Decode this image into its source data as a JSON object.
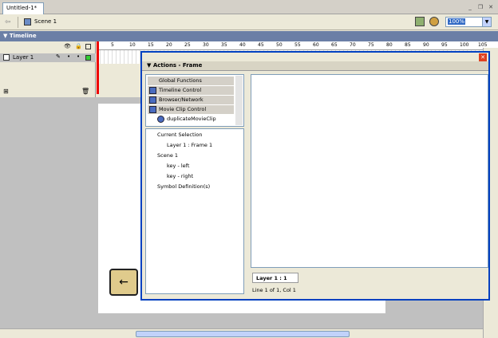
{
  "document": {
    "tab_label": "Untitled-1*"
  },
  "edit_bar": {
    "scene_label": "Scene 1",
    "zoom_value": "100%"
  },
  "timeline": {
    "header": "Timeline",
    "layer_name": "Layer 1",
    "ruler_ticks": [
      "5",
      "10",
      "15",
      "20",
      "25",
      "30",
      "35",
      "40",
      "45",
      "50",
      "55",
      "60",
      "65",
      "70",
      "75",
      "80",
      "85",
      "90",
      "95",
      "100",
      "105"
    ]
  },
  "actions_panel": {
    "title": "Actions - Frame",
    "toolbox_items": [
      "Global Functions",
      "Timeline Control",
      "Browser/Network",
      "Movie Clip Control",
      "duplicateMovieClip"
    ],
    "tree": {
      "current_selection": "Current Selection",
      "current_frame": "Layer 1 : Frame 1",
      "scene": "Scene 1",
      "items": [
        "key - left",
        "key - right"
      ],
      "symbols": "Symbol Definition(s)"
    },
    "script_tab": "Layer 1 : 1",
    "status": "Line 1 of 1, Col 1"
  },
  "stage": {
    "key_symbol": "←"
  }
}
